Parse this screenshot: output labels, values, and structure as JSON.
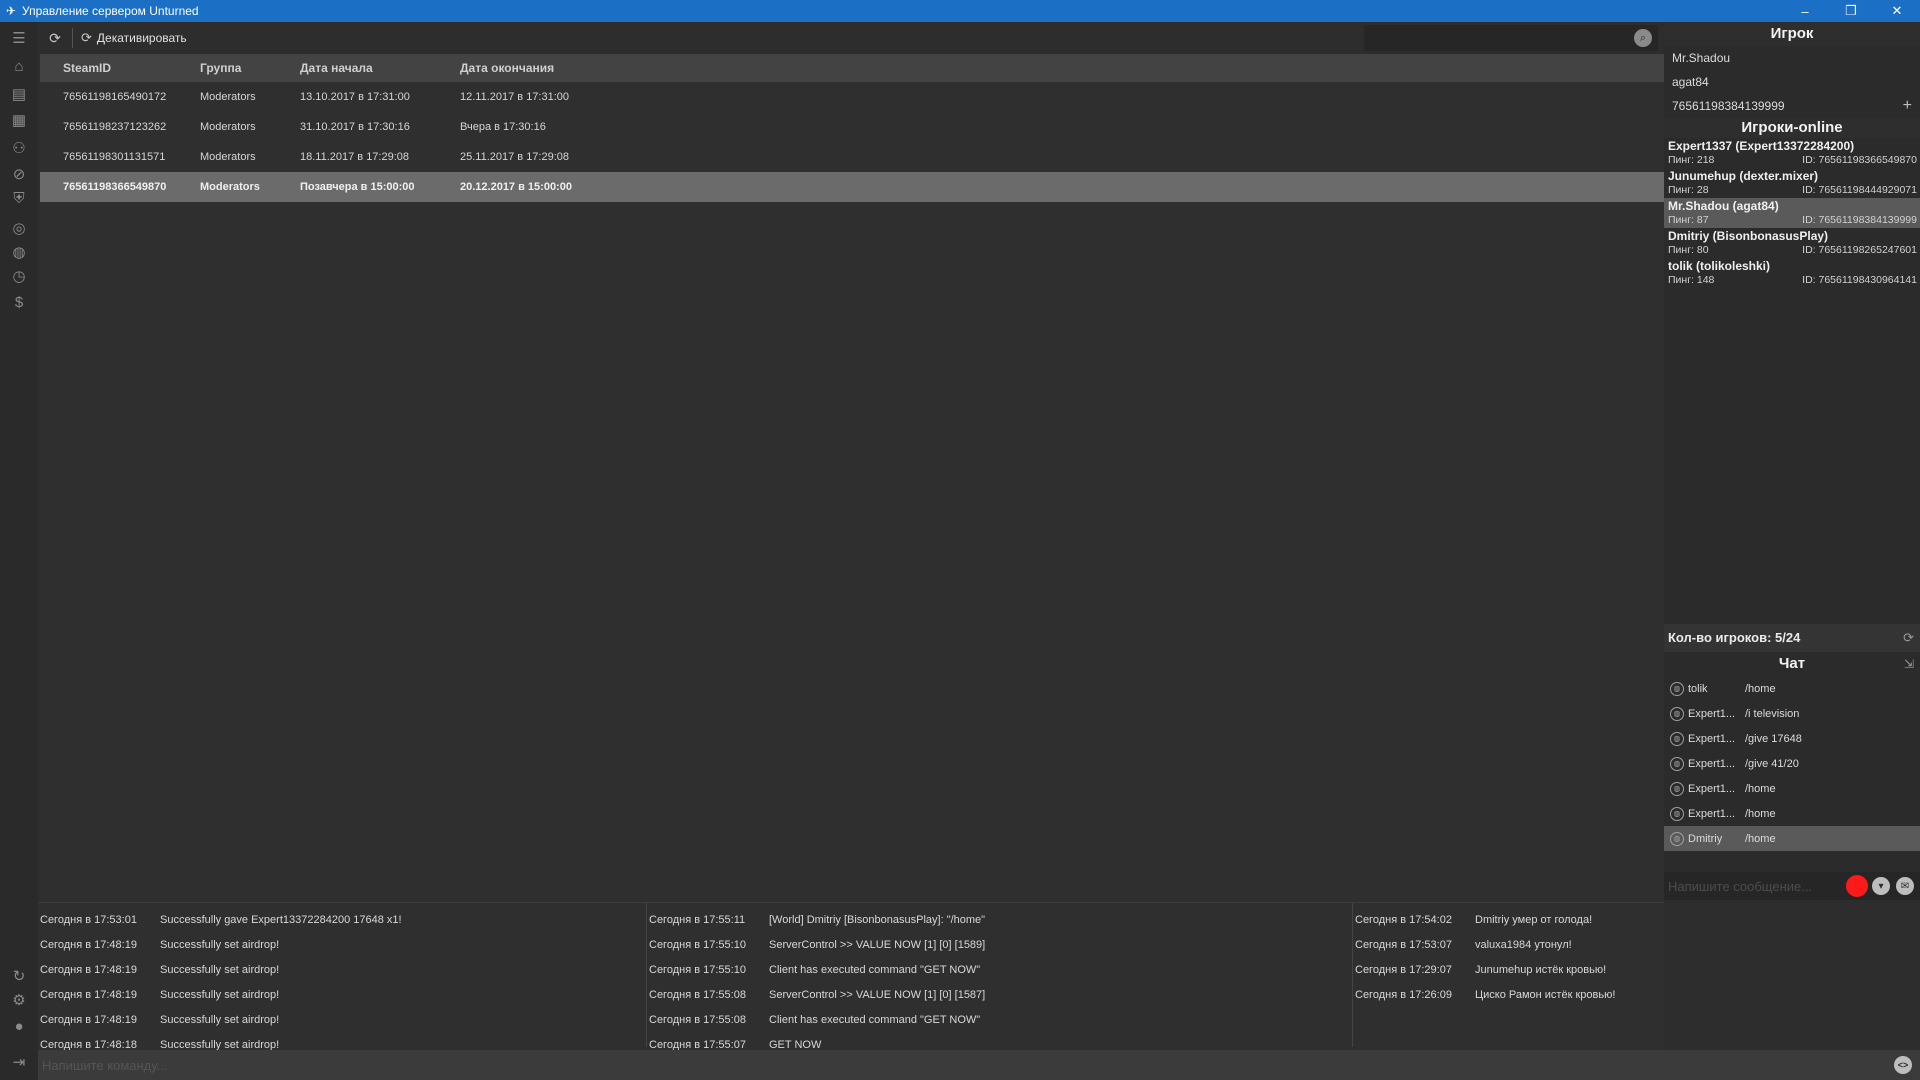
{
  "window": {
    "title": "Управление сервером Unturned",
    "minimize": "–",
    "restore": "❐",
    "close": "✕"
  },
  "colors": {
    "titlebar": "#1b6fc4",
    "background": "#2d2d2d",
    "selected_row": "#6b6b6b",
    "record_button": "#ff1a1a"
  },
  "toolbar": {
    "refresh_icon": "refresh-icon",
    "deactivate_label": "Декативировать",
    "search_placeholder": "",
    "search_icon": "search-icon"
  },
  "table": {
    "columns": [
      "SteamID",
      "Группа",
      "Дата начала",
      "Дата окончания"
    ],
    "rows": [
      [
        "76561198165490172",
        "Moderators",
        "13.10.2017 в 17:31:00",
        "12.11.2017 в 17:31:00"
      ],
      [
        "76561198237123262",
        "Moderators",
        "31.10.2017 в 17:30:16",
        "Вчера в 17:30:16"
      ],
      [
        "76561198301131571",
        "Moderators",
        "18.11.2017 в 17:29:08",
        "25.11.2017 в 17:29:08"
      ],
      [
        "76561198366549870",
        "Moderators",
        "Позавчера в 15:00:00",
        "20.12.2017 в 15:00:00"
      ]
    ]
  },
  "player_panel": {
    "title": "Игрок",
    "name": "Mr.Shadou",
    "login": "agat84",
    "steam_id": "76561198384139999",
    "add_icon": "+"
  },
  "online": {
    "title": "Игроки-online",
    "players": [
      {
        "name": "Expert1337 (Expert13372284200)",
        "ping": "Пинг: 218",
        "id": "ID: 76561198366549870"
      },
      {
        "name": "Junumehup (dexter.mixer)",
        "ping": "Пинг: 28",
        "id": "ID: 76561198444929071"
      },
      {
        "name": "Mr.Shadou (agat84)",
        "ping": "Пинг: 87",
        "id": "ID: 76561198384139999"
      },
      {
        "name": "Dmitriy (BisonbonasusPlay)",
        "ping": "Пинг: 80",
        "id": "ID: 76561198265247601"
      },
      {
        "name": "tolik (tolikoleshki)",
        "ping": "Пинг: 148",
        "id": "ID: 76561198430964141"
      }
    ],
    "count_label": "Кол-во игроков: 5/24"
  },
  "chat": {
    "title": "Чат",
    "messages": [
      {
        "name": "tolik",
        "text": "/home"
      },
      {
        "name": "Expert1...",
        "text": "/i television"
      },
      {
        "name": "Expert1...",
        "text": "/give 17648"
      },
      {
        "name": "Expert1...",
        "text": "/give 41/20"
      },
      {
        "name": "Expert1...",
        "text": "/home"
      },
      {
        "name": "Expert1...",
        "text": "/home"
      },
      {
        "name": "Dmitriy",
        "text": "/home"
      }
    ],
    "input_placeholder": "Напишите сообщение..."
  },
  "logs": {
    "panel1": [
      {
        "time": "Сегодня в 17:53:01",
        "text": "Successfully gave Expert13372284200 17648 x1!"
      },
      {
        "time": "Сегодня в 17:48:19",
        "text": "Successfully set airdrop!"
      },
      {
        "time": "Сегодня в 17:48:19",
        "text": "Successfully set airdrop!"
      },
      {
        "time": "Сегодня в 17:48:19",
        "text": "Successfully set airdrop!"
      },
      {
        "time": "Сегодня в 17:48:19",
        "text": "Successfully set airdrop!"
      },
      {
        "time": "Сегодня в 17:48:18",
        "text": "Successfully set airdrop!"
      }
    ],
    "panel2": [
      {
        "time": "Сегодня в 17:55:11",
        "text": "[World] Dmitriy [BisonbonasusPlay]: \"/home\""
      },
      {
        "time": "Сегодня в 17:55:10",
        "text": "ServerControl >> VALUE NOW [1] [0] [1589]"
      },
      {
        "time": "Сегодня в 17:55:10",
        "text": "Client has executed command \"GET NOW\""
      },
      {
        "time": "Сегодня в 17:55:08",
        "text": "ServerControl >> VALUE NOW [1] [0] [1587]"
      },
      {
        "time": "Сегодня в 17:55:08",
        "text": "Client has executed command \"GET NOW\""
      },
      {
        "time": "Сегодня в 17:55:07",
        "text": "GET NOW"
      }
    ],
    "panel3": [
      {
        "time": "Сегодня в 17:54:02",
        "text": "Dmitriy умер от голода!"
      },
      {
        "time": "Сегодня в 17:53:07",
        "text": "valuxa1984 утонул!"
      },
      {
        "time": "Сегодня в 17:29:07",
        "text": "Junumehup истёк кровью!"
      },
      {
        "time": "Сегодня в 17:26:09",
        "text": "Циско Рамон истёк кровью!"
      }
    ]
  },
  "command": {
    "placeholder": "Напишите команду..."
  }
}
